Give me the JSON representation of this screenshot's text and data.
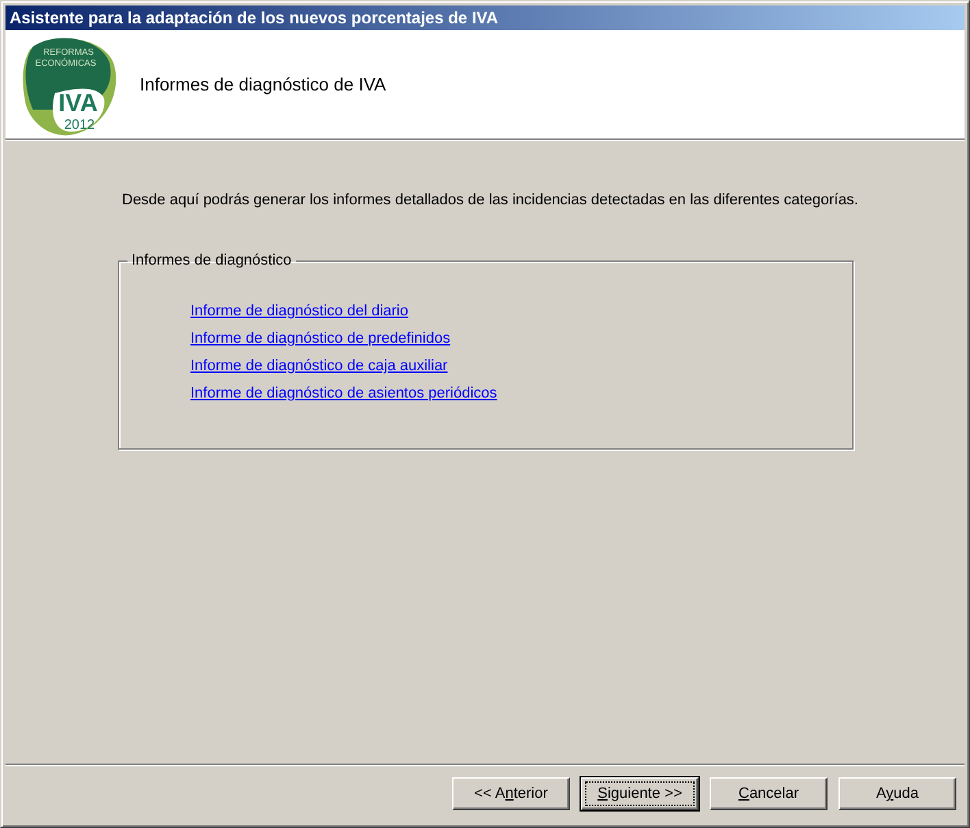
{
  "window": {
    "title": "Asistente para la adaptación de los nuevos porcentajes de IVA"
  },
  "logo": {
    "line_1": "REFORMAS",
    "line_2": "ECONÓMICAS",
    "big": "IVA",
    "year": "2012"
  },
  "header": {
    "title": "Informes de diagnóstico de IVA"
  },
  "intro": "Desde aquí podrás generar los informes detallados de las incidencias detectadas en las diferentes categorías.",
  "group": {
    "title": "Informes de diagnóstico",
    "links": [
      {
        "label": "Informe de diagnóstico del diario"
      },
      {
        "label": "Informe de diagnóstico de predefinidos"
      },
      {
        "label": "Informe de diagnóstico de caja auxiliar"
      },
      {
        "label": "Informe de diagnóstico de asientos periódicos"
      }
    ]
  },
  "buttons": [
    {
      "before": "<< A",
      "access_key": "n",
      "after": "terior",
      "default": false
    },
    {
      "access_key": "S",
      "after": "iguiente >>",
      "default": true
    },
    {
      "access_key": "C",
      "after": "ancelar",
      "default": false
    },
    {
      "before": "A",
      "access_key": "y",
      "after": "uda",
      "default": false
    }
  ]
}
